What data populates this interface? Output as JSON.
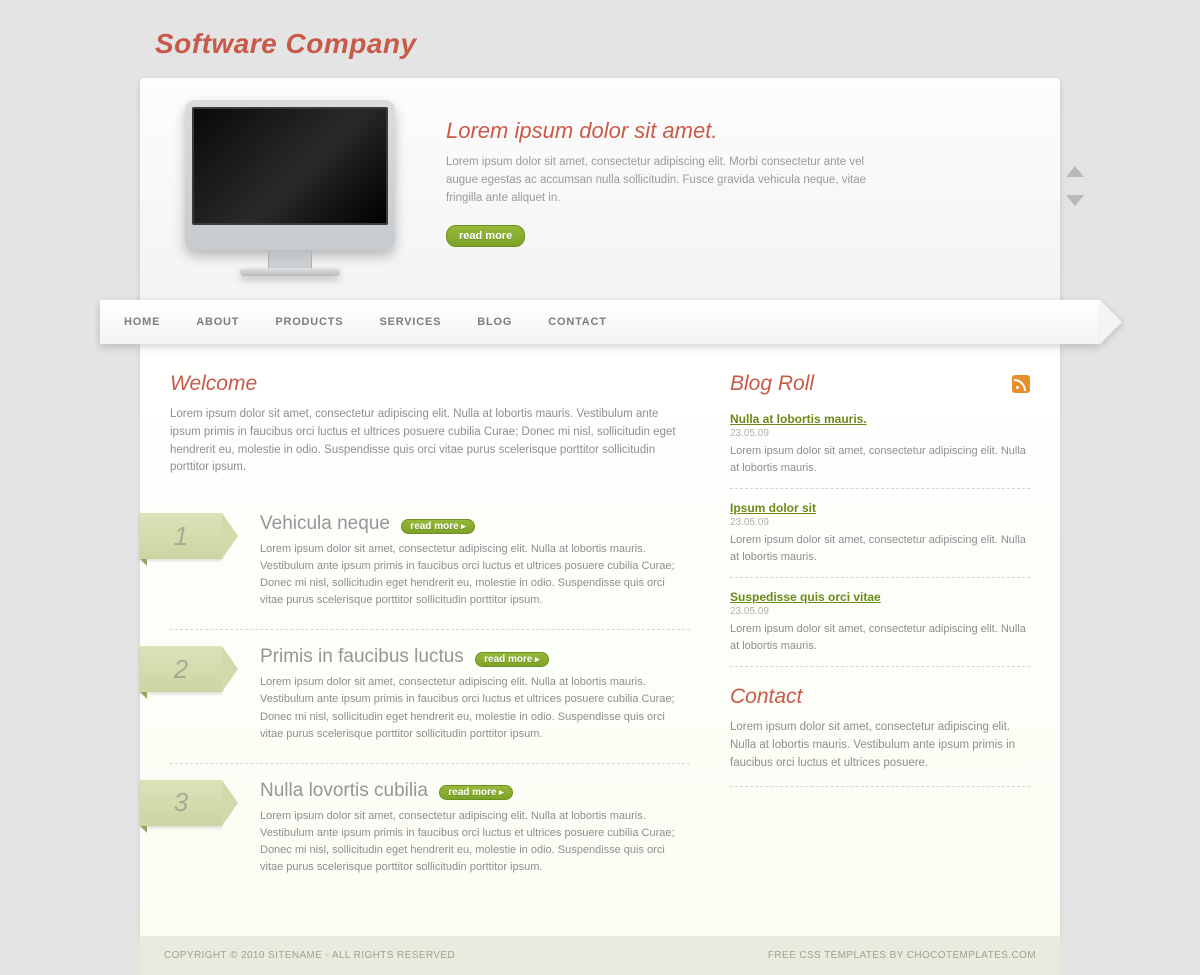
{
  "site": {
    "title": "Software Company"
  },
  "hero": {
    "heading": "Lorem ipsum dolor sit amet.",
    "body": "Lorem ipsum dolor sit amet, consectetur adipiscing elit. Morbi consectetur ante vel augue egestas ac accumsan nulla sollicitudin. Fusce gravida vehicula neque, vitae fringilla ante aliquet in.",
    "cta": "read more"
  },
  "nav": [
    "HOME",
    "ABOUT",
    "PRODUCTS",
    "SERVICES",
    "BLOG",
    "CONTACT"
  ],
  "welcome": {
    "title": "Welcome",
    "body": "Lorem ipsum dolor sit amet, consectetur adipiscing elit. Nulla at lobortis mauris. Vestibulum ante ipsum primis in faucibus orci luctus et ultrices posuere cubilia Curae; Donec mi nisl, sollicitudin eget hendrerit eu, molestie in odio. Suspendisse quis orci vitae purus scelerisque porttitor sollicitudin porttitor ipsum."
  },
  "features": [
    {
      "num": "1",
      "title": "Vehicula neque",
      "cta": "read more",
      "body": "Lorem ipsum dolor sit amet, consectetur adipiscing elit. Nulla at lobortis mauris. Vestibulum ante ipsum primis in faucibus orci luctus et ultrices posuere cubilia Curae; Donec mi nisl, sollicitudin eget hendrerit eu, molestie in odio. Suspendisse quis orci vitae purus scelerisque porttitor sollicitudin porttitor ipsum."
    },
    {
      "num": "2",
      "title": "Primis in faucibus luctus",
      "cta": "read more",
      "body": "Lorem ipsum dolor sit amet, consectetur adipiscing elit. Nulla at lobortis mauris. Vestibulum ante ipsum primis in faucibus orci luctus et ultrices posuere cubilia Curae; Donec mi nisl, sollicitudin eget hendrerit eu, molestie in odio. Suspendisse quis orci vitae purus scelerisque porttitor sollicitudin porttitor ipsum."
    },
    {
      "num": "3",
      "title": "Nulla lovortis cubilia",
      "cta": "read more",
      "body": "Lorem ipsum dolor sit amet, consectetur adipiscing elit. Nulla at lobortis mauris. Vestibulum ante ipsum primis in faucibus orci luctus et ultrices posuere cubilia Curae; Donec mi nisl, sollicitudin eget hendrerit eu, molestie in odio. Suspendisse quis orci vitae purus scelerisque porttitor sollicitudin porttitor ipsum."
    }
  ],
  "blog": {
    "title": "Blog Roll",
    "items": [
      {
        "title": "Nulla at lobortis mauris.",
        "date": "23.05.09",
        "body": "Lorem ipsum dolor sit amet, consectetur adipiscing elit. Nulla at lobortis mauris."
      },
      {
        "title": "Ipsum dolor sit",
        "date": "23.05.09",
        "body": "Lorem ipsum dolor sit amet, consectetur adipiscing elit. Nulla at lobortis mauris."
      },
      {
        "title": "Suspedisse quis orci vitae",
        "date": "23.05.09",
        "body": "Lorem ipsum dolor sit amet, consectetur adipiscing elit. Nulla at lobortis mauris."
      }
    ]
  },
  "contact": {
    "title": "Contact",
    "body": "Lorem ipsum dolor sit amet, consectetur adipiscing elit. Nulla at lobortis mauris. Vestibulum ante ipsum primis in faucibus orci luctus et ultrices posuere."
  },
  "footer": {
    "left": "COPYRIGHT © 2010 SITENAME - ALL RIGHTS RESERVED",
    "right": "FREE CSS TEMPLATES BY CHOCOTEMPLATES.COM"
  }
}
